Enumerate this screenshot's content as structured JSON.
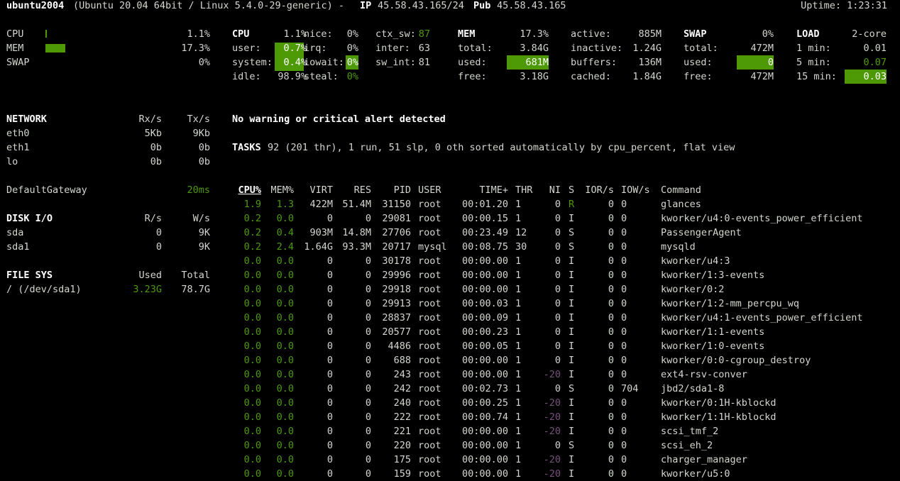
{
  "header": {
    "hostname": "ubuntu2004",
    "system": "(Ubuntu 20.04 64bit / Linux 5.4.0-29-generic) -",
    "ip_label": "IP",
    "ip": "45.58.43.165/24",
    "pub_label": "Pub",
    "pub": "45.58.43.165",
    "uptime": "Uptime: 1:23:31"
  },
  "quicklook": {
    "cpu_label": "CPU",
    "cpu_value": "1.1%",
    "cpu_pct": 1.1,
    "mem_label": "MEM",
    "mem_value": "17.3%",
    "mem_pct": 17.3,
    "swap_label": "SWAP",
    "swap_value": "0%",
    "swap_pct": 0
  },
  "cpu": {
    "title": "CPU",
    "total": "1.1%",
    "user_label": "user:",
    "user": "0.7%",
    "system_label": "system:",
    "system": "0.4%",
    "idle_label": "idle:",
    "idle": "98.9%",
    "nice_label": "nice:",
    "nice": "0%",
    "irq_label": "irq:",
    "irq": "0%",
    "iowait_label": "iowait:",
    "iowait": "0%",
    "steal_label": "steal:",
    "steal": "0%",
    "ctx_sw_label": "ctx_sw:",
    "ctx_sw": "87",
    "inter_label": "inter:",
    "inter": "63",
    "sw_int_label": "sw_int:",
    "sw_int": "81"
  },
  "mem": {
    "title": "MEM",
    "pct": "17.3%",
    "total_label": "total:",
    "total": "3.84G",
    "used_label": "used:",
    "used": "681M",
    "free_label": "free:",
    "free": "3.18G",
    "active_label": "active:",
    "active": "885M",
    "inactive_label": "inactive:",
    "inactive": "1.24G",
    "buffers_label": "buffers:",
    "buffers": "136M",
    "cached_label": "cached:",
    "cached": "1.84G"
  },
  "swap": {
    "title": "SWAP",
    "pct": "0%",
    "total_label": "total:",
    "total": "472M",
    "used_label": "used:",
    "used": "0",
    "free_label": "free:",
    "free": "472M"
  },
  "load": {
    "title": "LOAD",
    "cores": "2-core",
    "m1_label": "1 min:",
    "m1": "0.01",
    "m5_label": "5 min:",
    "m5": "0.07",
    "m15_label": "15 min:",
    "m15": "0.03"
  },
  "network": {
    "title": "NETWORK",
    "rx_header": "Rx/s",
    "tx_header": "Tx/s",
    "rows": [
      {
        "name": "eth0",
        "rx": "5Kb",
        "tx": "9Kb"
      },
      {
        "name": "eth1",
        "rx": "0b",
        "tx": "0b"
      },
      {
        "name": "lo",
        "rx": "0b",
        "tx": "0b"
      }
    ]
  },
  "gateway": {
    "label": "DefaultGateway",
    "value": "20ms"
  },
  "disk": {
    "title": "DISK I/O",
    "r_header": "R/s",
    "w_header": "W/s",
    "rows": [
      {
        "name": "sda",
        "r": "0",
        "w": "9K"
      },
      {
        "name": "sda1",
        "r": "0",
        "w": "9K"
      }
    ]
  },
  "fs": {
    "title": "FILE SYS",
    "used_header": "Used",
    "total_header": "Total",
    "rows": [
      {
        "name": "/ (/dev/sda1)",
        "used": "3.23G",
        "total": "78.7G"
      }
    ]
  },
  "alert": "No warning or critical alert detected",
  "tasks": {
    "label": "TASKS",
    "summary": "92 (201 thr), 1 run, 51 slp, 0 oth sorted automatically by cpu_percent, flat view"
  },
  "proc_headers": {
    "cpu": "CPU%",
    "mem": "MEM%",
    "virt": "VIRT",
    "res": "RES",
    "pid": "PID",
    "user": "USER",
    "time": "TIME+",
    "thr": "THR",
    "ni": "NI",
    "s": "S",
    "ior": "IOR/s",
    "iow": "IOW/s",
    "cmd": "Command"
  },
  "processes": [
    {
      "cpu": "1.9",
      "mem": "1.3",
      "virt": "422M",
      "res": "51.4M",
      "pid": "31150",
      "user": "root",
      "time": "00:01.20",
      "thr": "1",
      "ni": "0",
      "s": "R",
      "ior": "0",
      "iow": "0",
      "cmd": "glances"
    },
    {
      "cpu": "0.2",
      "mem": "0.0",
      "virt": "0",
      "res": "0",
      "pid": "29081",
      "user": "root",
      "time": "00:00.15",
      "thr": "1",
      "ni": "0",
      "s": "I",
      "ior": "0",
      "iow": "0",
      "cmd": "kworker/u4:0-events_power_efficient"
    },
    {
      "cpu": "0.2",
      "mem": "0.4",
      "virt": "903M",
      "res": "14.8M",
      "pid": "27706",
      "user": "root",
      "time": "00:23.49",
      "thr": "12",
      "ni": "0",
      "s": "S",
      "ior": "0",
      "iow": "0",
      "cmd": "PassengerAgent"
    },
    {
      "cpu": "0.2",
      "mem": "2.4",
      "virt": "1.64G",
      "res": "93.3M",
      "pid": "20717",
      "user": "mysql",
      "time": "00:08.75",
      "thr": "30",
      "ni": "0",
      "s": "S",
      "ior": "0",
      "iow": "0",
      "cmd": "mysqld"
    },
    {
      "cpu": "0.0",
      "mem": "0.0",
      "virt": "0",
      "res": "0",
      "pid": "30178",
      "user": "root",
      "time": "00:00.00",
      "thr": "1",
      "ni": "0",
      "s": "I",
      "ior": "0",
      "iow": "0",
      "cmd": "kworker/u4:3"
    },
    {
      "cpu": "0.0",
      "mem": "0.0",
      "virt": "0",
      "res": "0",
      "pid": "29996",
      "user": "root",
      "time": "00:00.00",
      "thr": "1",
      "ni": "0",
      "s": "I",
      "ior": "0",
      "iow": "0",
      "cmd": "kworker/1:3-events"
    },
    {
      "cpu": "0.0",
      "mem": "0.0",
      "virt": "0",
      "res": "0",
      "pid": "29918",
      "user": "root",
      "time": "00:00.00",
      "thr": "1",
      "ni": "0",
      "s": "I",
      "ior": "0",
      "iow": "0",
      "cmd": "kworker/0:2"
    },
    {
      "cpu": "0.0",
      "mem": "0.0",
      "virt": "0",
      "res": "0",
      "pid": "29913",
      "user": "root",
      "time": "00:00.03",
      "thr": "1",
      "ni": "0",
      "s": "I",
      "ior": "0",
      "iow": "0",
      "cmd": "kworker/1:2-mm_percpu_wq"
    },
    {
      "cpu": "0.0",
      "mem": "0.0",
      "virt": "0",
      "res": "0",
      "pid": "28837",
      "user": "root",
      "time": "00:00.09",
      "thr": "1",
      "ni": "0",
      "s": "I",
      "ior": "0",
      "iow": "0",
      "cmd": "kworker/u4:1-events_power_efficient"
    },
    {
      "cpu": "0.0",
      "mem": "0.0",
      "virt": "0",
      "res": "0",
      "pid": "20577",
      "user": "root",
      "time": "00:00.23",
      "thr": "1",
      "ni": "0",
      "s": "I",
      "ior": "0",
      "iow": "0",
      "cmd": "kworker/1:1-events"
    },
    {
      "cpu": "0.0",
      "mem": "0.0",
      "virt": "0",
      "res": "0",
      "pid": "4486",
      "user": "root",
      "time": "00:00.05",
      "thr": "1",
      "ni": "0",
      "s": "I",
      "ior": "0",
      "iow": "0",
      "cmd": "kworker/1:0-events"
    },
    {
      "cpu": "0.0",
      "mem": "0.0",
      "virt": "0",
      "res": "0",
      "pid": "688",
      "user": "root",
      "time": "00:00.00",
      "thr": "1",
      "ni": "0",
      "s": "I",
      "ior": "0",
      "iow": "0",
      "cmd": "kworker/0:0-cgroup_destroy"
    },
    {
      "cpu": "0.0",
      "mem": "0.0",
      "virt": "0",
      "res": "0",
      "pid": "243",
      "user": "root",
      "time": "00:00.00",
      "thr": "1",
      "ni": "-20",
      "s": "I",
      "ior": "0",
      "iow": "0",
      "cmd": "ext4-rsv-conver"
    },
    {
      "cpu": "0.0",
      "mem": "0.0",
      "virt": "0",
      "res": "0",
      "pid": "242",
      "user": "root",
      "time": "00:02.73",
      "thr": "1",
      "ni": "0",
      "s": "S",
      "ior": "0",
      "iow": "704",
      "cmd": "jbd2/sda1-8"
    },
    {
      "cpu": "0.0",
      "mem": "0.0",
      "virt": "0",
      "res": "0",
      "pid": "240",
      "user": "root",
      "time": "00:00.25",
      "thr": "1",
      "ni": "-20",
      "s": "I",
      "ior": "0",
      "iow": "0",
      "cmd": "kworker/0:1H-kblockd"
    },
    {
      "cpu": "0.0",
      "mem": "0.0",
      "virt": "0",
      "res": "0",
      "pid": "222",
      "user": "root",
      "time": "00:00.74",
      "thr": "1",
      "ni": "-20",
      "s": "I",
      "ior": "0",
      "iow": "0",
      "cmd": "kworker/1:1H-kblockd"
    },
    {
      "cpu": "0.0",
      "mem": "0.0",
      "virt": "0",
      "res": "0",
      "pid": "221",
      "user": "root",
      "time": "00:00.00",
      "thr": "1",
      "ni": "-20",
      "s": "I",
      "ior": "0",
      "iow": "0",
      "cmd": "scsi_tmf_2"
    },
    {
      "cpu": "0.0",
      "mem": "0.0",
      "virt": "0",
      "res": "0",
      "pid": "220",
      "user": "root",
      "time": "00:00.00",
      "thr": "1",
      "ni": "0",
      "s": "S",
      "ior": "0",
      "iow": "0",
      "cmd": "scsi_eh_2"
    },
    {
      "cpu": "0.0",
      "mem": "0.0",
      "virt": "0",
      "res": "0",
      "pid": "175",
      "user": "root",
      "time": "00:00.00",
      "thr": "1",
      "ni": "-20",
      "s": "I",
      "ior": "0",
      "iow": "0",
      "cmd": "charger_manager"
    },
    {
      "cpu": "0.0",
      "mem": "0.0",
      "virt": "0",
      "res": "0",
      "pid": "159",
      "user": "root",
      "time": "00:00.00",
      "thr": "1",
      "ni": "-20",
      "s": "I",
      "ior": "0",
      "iow": "0",
      "cmd": "kworker/u5:0"
    }
  ]
}
